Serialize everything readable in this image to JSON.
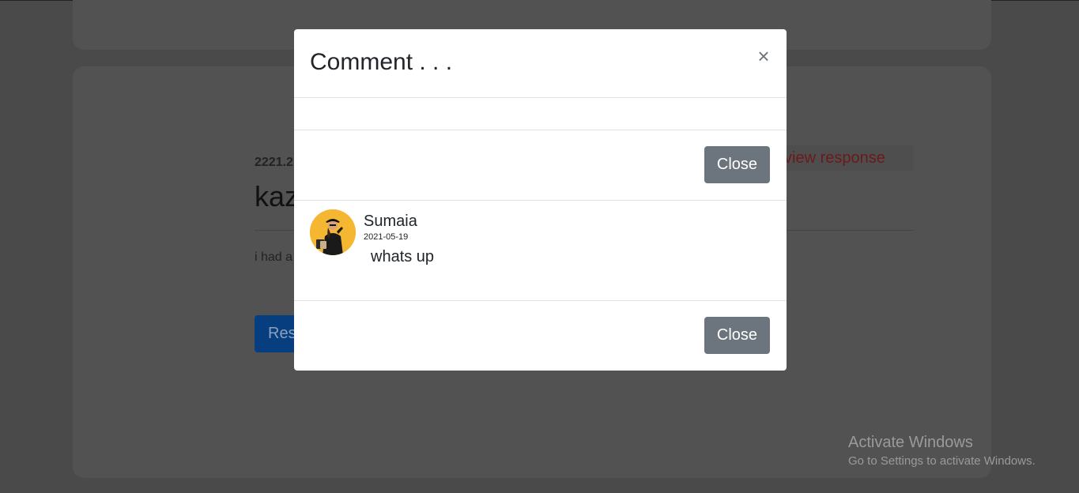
{
  "background": {
    "post_date": "2221.2",
    "post_title": "kaz",
    "post_body": "i had a",
    "respond_button": "Res",
    "view_response_link": "view response"
  },
  "modal": {
    "title": "Comment . . .",
    "close_x": "×",
    "close_button_top": "Close",
    "close_button_bottom": "Close",
    "comment": {
      "author": "Sumaia",
      "date": "2021-05-19",
      "text": "whats up"
    }
  },
  "watermark": {
    "line1": "Activate Windows",
    "line2": "Go to Settings to activate Windows."
  },
  "colors": {
    "overlay": "#4a4a4a",
    "secondary_button": "#6c757d",
    "avatar_bg": "#f5b731"
  }
}
